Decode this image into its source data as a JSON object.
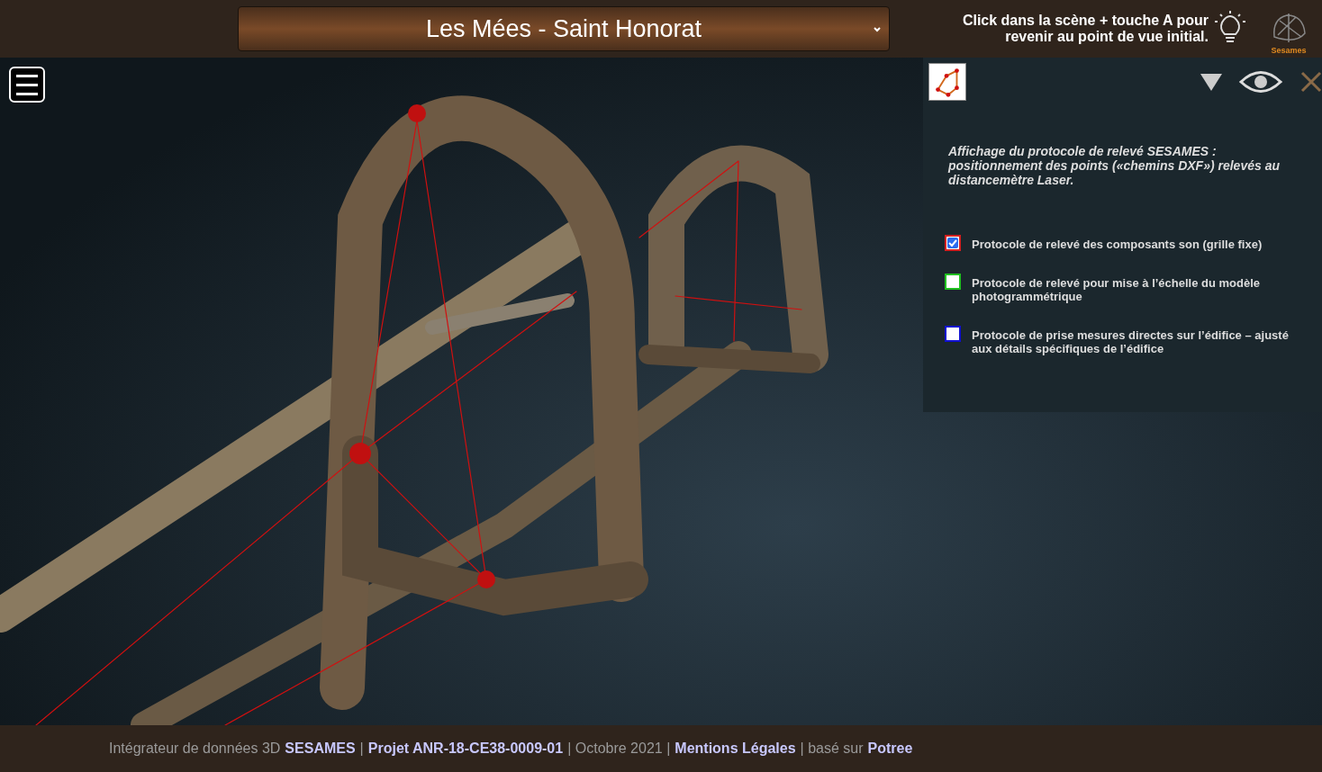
{
  "header": {
    "title": "Les Mées - Saint Honorat",
    "hint": "Click dans la scène + touche A pour revenir au point de vue initial.",
    "logo_label": "Sesames"
  },
  "panel": {
    "description": "Affichage du protocole de relevé SESAMES : positionnement des points («chemins DXF») relevés au distancemètre Laser.",
    "layers": [
      {
        "label": "Protocole de relevé des composants son (grille fixe)",
        "checked": true,
        "color": "#d42020"
      },
      {
        "label": "Protocole de relevé pour mise à l’échelle du modèle photogrammétrique",
        "checked": false,
        "color": "#20c020"
      },
      {
        "label": "Protocole de prise mesures directes sur l’édifice – ajusté aux détails spécifiques de l’édifice",
        "checked": false,
        "color": "#1010d0"
      }
    ]
  },
  "footer": [
    {
      "text": "Intégrateur de données 3D",
      "kind": "text"
    },
    {
      "text": "SESAMES",
      "kind": "link"
    },
    {
      "text": "|",
      "kind": "text"
    },
    {
      "text": "Projet ANR-18-CE38-0009-01",
      "kind": "link"
    },
    {
      "text": "| Octobre 2021 |",
      "kind": "text"
    },
    {
      "text": "Mentions Légales",
      "kind": "link"
    },
    {
      "text": "| basé sur",
      "kind": "text"
    },
    {
      "text": "Potree",
      "kind": "link"
    }
  ]
}
